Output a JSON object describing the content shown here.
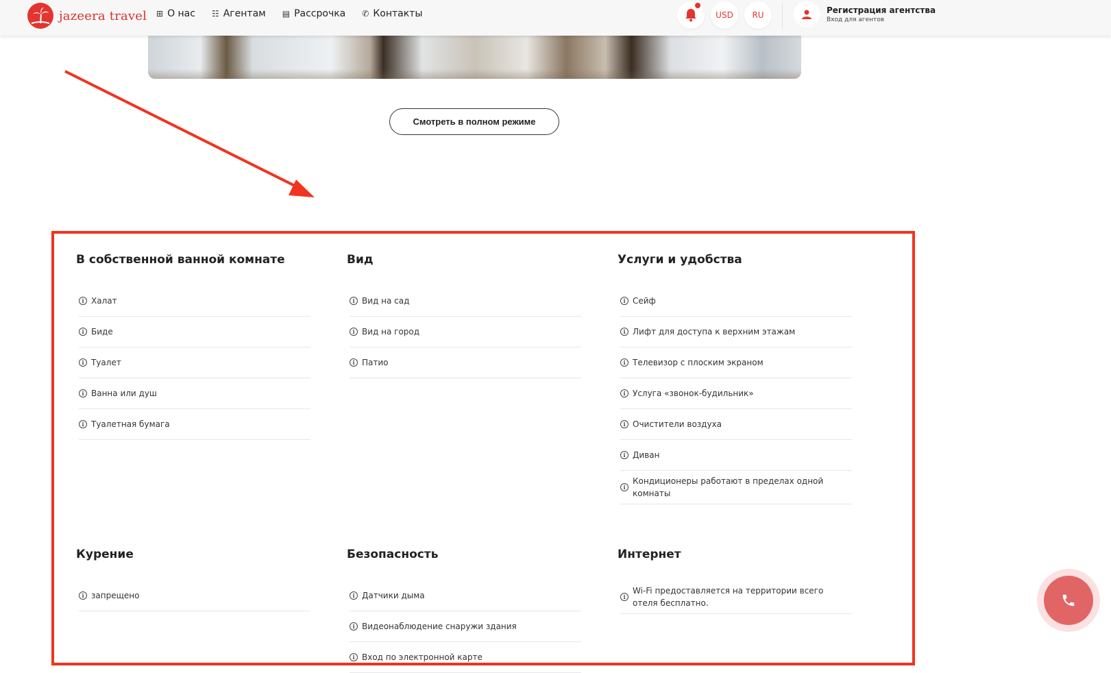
{
  "header": {
    "logo_text": "jazeera travel",
    "nav": [
      {
        "icon": "grid-icon",
        "label": "О нас"
      },
      {
        "icon": "agents-icon",
        "label": "Агентам"
      },
      {
        "icon": "calculator-icon",
        "label": "Рассрочка"
      },
      {
        "icon": "phone-icon",
        "label": "Контакты"
      }
    ],
    "currency": "USD",
    "language": "RU",
    "agent_title": "Регистрация агентства",
    "agent_subtitle": "Вход для агентов",
    "accent_color": "#e3342f"
  },
  "fullscreen_button": "Смотреть в полном режиме",
  "annotation_color": "#f0341f",
  "amenity_groups": [
    {
      "title": "В собственной ванной комнате",
      "items": [
        "Халат",
        "Биде",
        "Туалет",
        "Ванна или душ",
        "Туалетная бумага"
      ]
    },
    {
      "title": "Вид",
      "items": [
        "Вид на сад",
        "Вид на город",
        "Патио"
      ]
    },
    {
      "title": "Услуги и удобства",
      "items": [
        "Сейф",
        "Лифт для доступа к верхним этажам",
        "Телевизор с плоским экраном",
        "Услуга «звонок-будильник»",
        "Очистители воздуха",
        "Диван",
        "Кондиционеры работают в пределах одной комнаты"
      ]
    },
    {
      "title": "Курение",
      "items": [
        "запрещено"
      ]
    },
    {
      "title": "Безопасность",
      "items": [
        "Датчики дыма",
        "Видеонаблюдение снаружи здания",
        "Вход по электронной карте"
      ]
    },
    {
      "title": "Интернет",
      "items": [
        "Wi-Fi предоставляется на территории всего отеля бесплатно."
      ]
    }
  ]
}
